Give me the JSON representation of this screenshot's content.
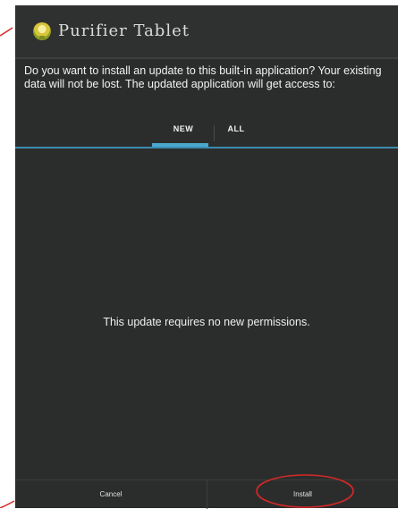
{
  "dialog": {
    "title": "Purifier Tablet",
    "message": "Do you want to install an update to this built-in application? Your existing data will not be lost. The updated application will get access to:",
    "tabs": [
      {
        "label": "NEW",
        "selected": true
      },
      {
        "label": "ALL",
        "selected": false
      }
    ],
    "body_message": "This update requires no new permissions.",
    "buttons": {
      "cancel_label": "Cancel",
      "install_label": "Install"
    },
    "app_icon": "app-icon"
  },
  "colors": {
    "dialog_background": "#2b2d2c",
    "tab_indicator": "#4aa8cf",
    "annotation_mark": "#d62828"
  }
}
